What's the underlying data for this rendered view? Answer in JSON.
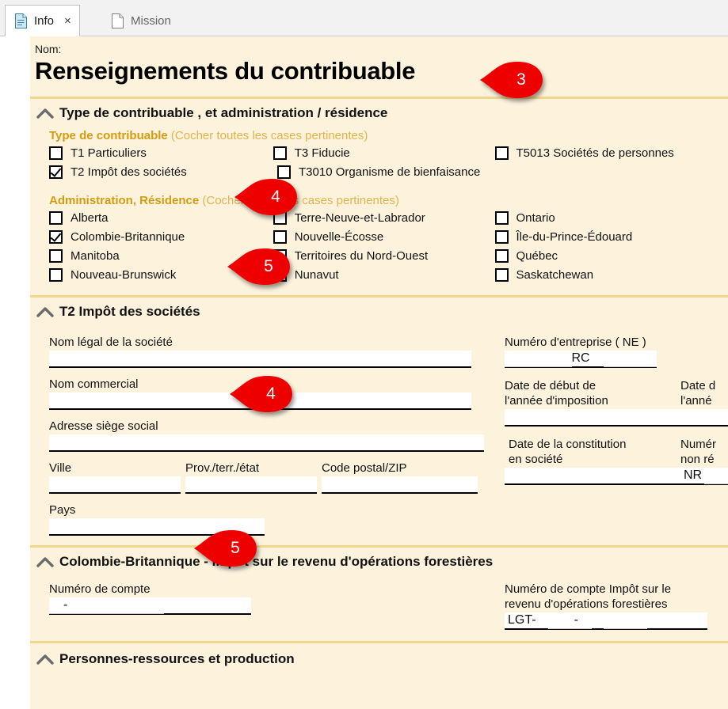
{
  "window": {
    "tabs": [
      {
        "label": "Info",
        "icon": "document-icon",
        "active": true,
        "close_label": "×"
      },
      {
        "label": "Mission",
        "icon": "document-icon",
        "active": false
      }
    ]
  },
  "form": {
    "nom_label": "Nom:",
    "title": "Renseignements du contribuable",
    "sections": [
      {
        "id": "type-contribuable",
        "header": "Type de contribuable , et administration / résidence",
        "subsections": [
          {
            "id": "type-de-contribuable",
            "heading_bold": "Type de contribuable",
            "heading_note": "(Cocher toutes les cases pertinentes)",
            "rows": [
              [
                {
                  "label": "T1 Particuliers",
                  "checked": false
                },
                {
                  "label": "T3 Fiducie",
                  "checked": false
                },
                {
                  "label": "T5013 Sociétés de personnes",
                  "checked": false
                }
              ],
              [
                {
                  "label": "T2 Impôt des sociétés",
                  "checked": true
                },
                {
                  "label": "T3010 Organisme de bienfaisance",
                  "checked": false
                },
                {
                  "label": "",
                  "checked": null
                }
              ]
            ]
          },
          {
            "id": "administration-residence",
            "heading_bold": "Administration, Résidence",
            "heading_note": "(Cocher toutes les cases pertinentes)",
            "rows": [
              [
                {
                  "label": "Alberta",
                  "checked": false
                },
                {
                  "label": "Terre-Neuve-et-Labrador",
                  "checked": false
                },
                {
                  "label": "Ontario",
                  "checked": false
                }
              ],
              [
                {
                  "label": "Colombie-Britannique",
                  "checked": true
                },
                {
                  "label": "Nouvelle-Écosse",
                  "checked": false
                },
                {
                  "label": "Île-du-Prince-Édouard",
                  "checked": false
                }
              ],
              [
                {
                  "label": "Manitoba",
                  "checked": false
                },
                {
                  "label": "Territoires du Nord-Ouest",
                  "checked": false
                },
                {
                  "label": "Québec",
                  "checked": false
                }
              ],
              [
                {
                  "label": "Nouveau-Brunswick",
                  "checked": false
                },
                {
                  "label": "Nunavut",
                  "checked": false
                },
                {
                  "label": "Saskatchewan",
                  "checked": false
                }
              ]
            ]
          }
        ]
      },
      {
        "id": "t2-impot-societes",
        "header": "T2 Impôt des sociétés",
        "fields_left": [
          {
            "id": "nom-legal-societe",
            "label": "Nom légal de la société",
            "value": ""
          },
          {
            "id": "nom-commercial",
            "label": "Nom commercial",
            "value": ""
          },
          {
            "id": "adresse-siege-social",
            "label": "Adresse siège social",
            "value": ""
          }
        ],
        "fields_city_row": [
          {
            "id": "ville",
            "label": "Ville",
            "value": ""
          },
          {
            "id": "prov-terr-etat",
            "label": "Prov./terr./état",
            "value": ""
          },
          {
            "id": "code-postal-zip",
            "label": "Code postal/ZIP",
            "value": ""
          }
        ],
        "field_pays": {
          "id": "pays",
          "label": "Pays",
          "value": ""
        },
        "fields_right": [
          {
            "id": "numero-entreprise",
            "label": "Numéro d'entreprise ( NE )",
            "value": "RC"
          },
          {
            "id": "date-debut-annee-imposition",
            "label_line1": "Date de début de",
            "label_line2": "l'année d'imposition",
            "value": ""
          },
          {
            "id": "date-fin-annee-imposition",
            "label_line1": "Date d",
            "label_line2": "l'anné",
            "value": ""
          },
          {
            "id": "date-constitution-societe",
            "label_line1": "Date de la constitution",
            "label_line2": "en société",
            "value": ""
          },
          {
            "id": "numero-non-resident",
            "label_line1": "Numér",
            "label_line2": "non ré",
            "value": "NR"
          }
        ]
      },
      {
        "id": "cb-impot-revenu-forestier",
        "header": "Colombie-Britannique - Impôt sur le revenu d'opérations forestières",
        "fields": [
          {
            "id": "numero-de-compte",
            "label": "Numéro de compte",
            "value": "-"
          },
          {
            "id": "numero-compte-impot-forestier",
            "label_line1": "Numéro de compte Impôt sur le",
            "label_line2": "revenu d'opérations forestières",
            "value_prefix": "LGT-",
            "value_mid": "-"
          }
        ]
      },
      {
        "id": "personnes-ressources-production",
        "header": "Personnes-ressources et production"
      }
    ]
  },
  "callouts": [
    {
      "id": "callout-3",
      "number": "3"
    },
    {
      "id": "callout-4a",
      "number": "4"
    },
    {
      "id": "callout-5a",
      "number": "5"
    },
    {
      "id": "callout-4b",
      "number": "4"
    },
    {
      "id": "callout-5b",
      "number": "5"
    }
  ],
  "colors": {
    "sheet_background": "#fdf3dd",
    "divider": "#f0d78a",
    "gold_heading": "#d29b12",
    "gold_note": "#e0b34e",
    "callout_red": "#ee0000",
    "tab_active_bg": "#ffffff",
    "field_bg": "#ffffff"
  }
}
